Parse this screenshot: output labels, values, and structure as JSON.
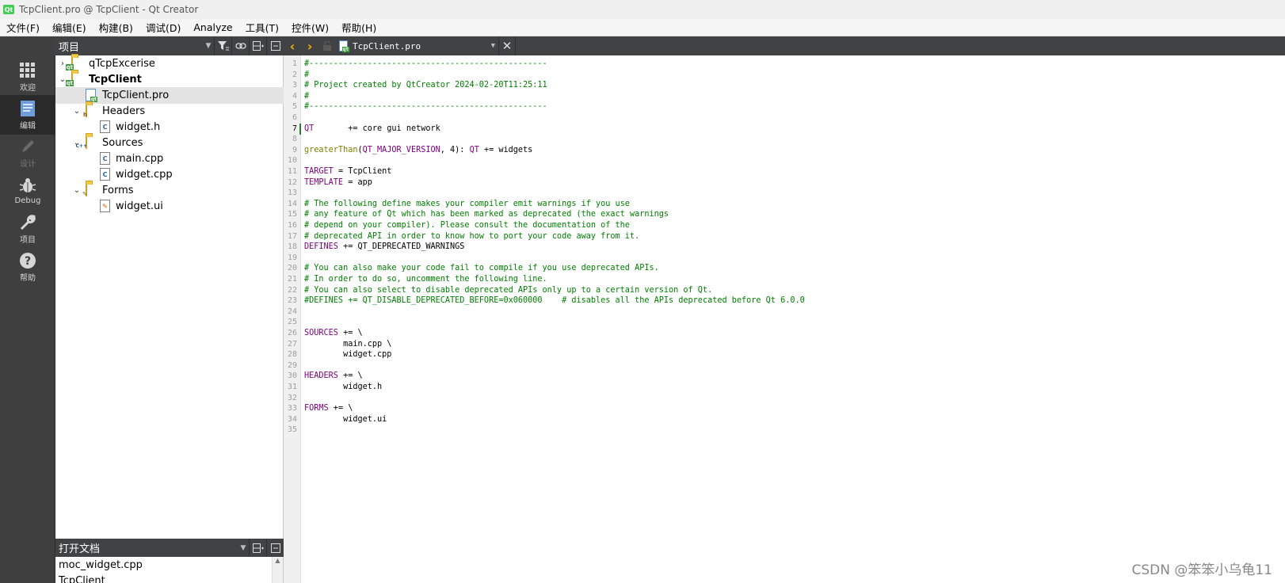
{
  "window": {
    "title": "TcpClient.pro @ TcpClient - Qt Creator",
    "logo_text": "Qt"
  },
  "menubar": [
    "文件(F)",
    "编辑(E)",
    "构建(B)",
    "调试(D)",
    "Analyze",
    "工具(T)",
    "控件(W)",
    "帮助(H)"
  ],
  "modes": [
    {
      "label": "欢迎",
      "icon": "grid-icon",
      "active": false,
      "disabled": false
    },
    {
      "label": "编辑",
      "icon": "edit-document-icon",
      "active": true,
      "disabled": false
    },
    {
      "label": "设计",
      "icon": "pencil-icon",
      "active": false,
      "disabled": true
    },
    {
      "label": "Debug",
      "icon": "bug-icon",
      "active": false,
      "disabled": false
    },
    {
      "label": "项目",
      "icon": "wrench-icon",
      "active": false,
      "disabled": false
    },
    {
      "label": "帮助",
      "icon": "help-icon",
      "active": false,
      "disabled": false
    }
  ],
  "project_panel": {
    "title": "项目",
    "tree": [
      {
        "label": "qTcpExcerise",
        "type": "project",
        "expanded": false,
        "bold": false,
        "selected": false
      },
      {
        "label": "TcpClient",
        "type": "project",
        "expanded": true,
        "bold": true,
        "selected": false
      },
      {
        "label": "TcpClient.pro",
        "type": "pro-file",
        "selected": true
      },
      {
        "label": "Headers",
        "type": "headers-folder",
        "expanded": true
      },
      {
        "label": "widget.h",
        "type": "header-file"
      },
      {
        "label": "Sources",
        "type": "sources-folder",
        "expanded": true
      },
      {
        "label": "main.cpp",
        "type": "cpp-file"
      },
      {
        "label": "widget.cpp",
        "type": "cpp-file"
      },
      {
        "label": "Forms",
        "type": "forms-folder",
        "expanded": true
      },
      {
        "label": "widget.ui",
        "type": "ui-file"
      }
    ]
  },
  "open_documents": {
    "title": "打开文档",
    "items": [
      "moc_widget.cpp",
      "TcpClient"
    ]
  },
  "editor": {
    "file_name": "TcpClient.pro",
    "current_line": 7,
    "line_count": 35
  },
  "watermark": "CSDN @笨笨小乌龟11"
}
